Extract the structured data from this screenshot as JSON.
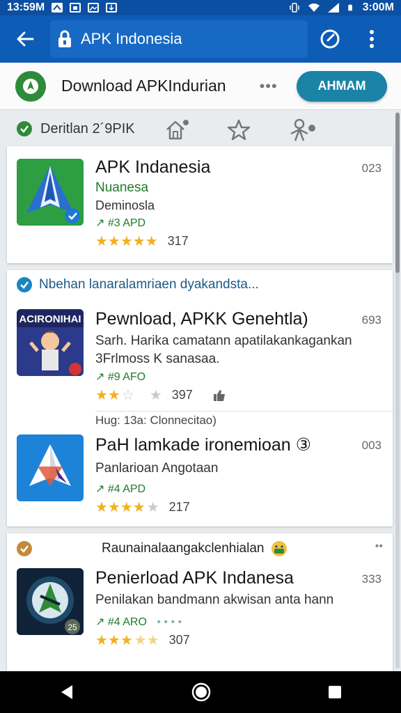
{
  "status_bar": {
    "time_left": "13:59M",
    "time_right": "3:00M"
  },
  "app_bar": {
    "url_text": "APK Indonesia",
    "icons": [
      "back-arrow-icon",
      "lock-icon",
      "refresh-compass-icon",
      "more-vert-icon"
    ]
  },
  "download_header": {
    "title": "Download APKIndurian",
    "dots": "•••",
    "button_label": "AHMAM"
  },
  "filter_row": {
    "label": "Deritlan 2´9PIK"
  },
  "card1": {
    "app_name": "APK Indanesia",
    "subtitle_green": "Nuanesa",
    "subtitle": "Deminosla",
    "meta": "↗ #3 APD",
    "stars": 5,
    "rating_count": "317",
    "count_right": "023"
  },
  "card2": {
    "section_title": "Nbehan lanaralamriaen dyakandsta...",
    "app1": {
      "icon_text": "ACIRONIHAI",
      "app_name": "Pewnload, APKK Genehtla)",
      "desc_line1": "Sarh. Harika camatann apatilakankagankan",
      "desc_line2": "3Frlmoss K sanasaa.",
      "meta": "↗ #9 AFO",
      "stars": 2,
      "rating_count": "397",
      "count_right": "693"
    },
    "caption": "Hug: 13a: Clonnecitao)",
    "app2": {
      "app_name": "PaH lamkade ironemioan ③",
      "subtitle": "Panlarioan Angotaan",
      "meta": "↗ #4 APD",
      "stars": 4,
      "rating_count": "217",
      "count_right": "003"
    }
  },
  "card3": {
    "section_title": "Raunainalaangakclenhialan",
    "section_dots": "••",
    "app": {
      "app_name": "Penierload APK Indanesa",
      "subtitle": "Penilakan bandmann akwisan anta hann",
      "meta": "↗ #4 ARO",
      "meta_dots": "• • • •",
      "stars": 3,
      "rating_count": "307",
      "count_right": "333"
    }
  },
  "colors": {
    "app_bar": "#0d5cb6",
    "status_bar": "#0b4fa3",
    "accent_button": "#1b83a6",
    "green": "#2e8b3a",
    "star": "#f0b020"
  }
}
